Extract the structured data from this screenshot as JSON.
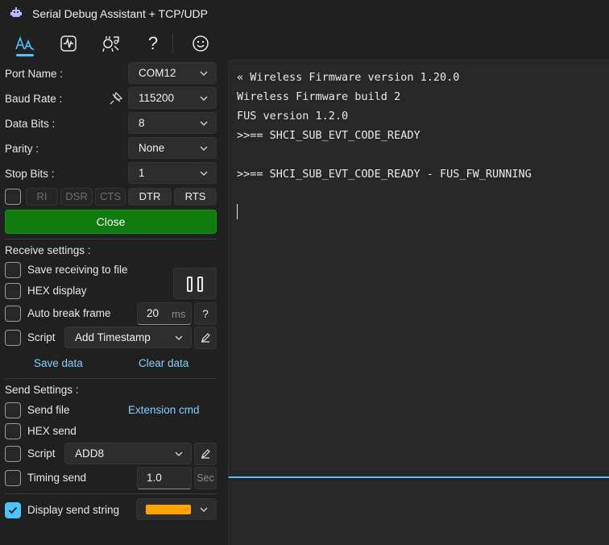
{
  "window": {
    "title": "Serial Debug Assistant + TCP/UDP"
  },
  "toolbar": {
    "icons": [
      "font-settings-icon",
      "waveform-icon",
      "tools-icon",
      "help-icon",
      "smiley-icon"
    ],
    "help_glyph": "?",
    "accent": "#4cc2ff"
  },
  "port": {
    "port_name_label": "Port Name :",
    "port_name_value": "COM12",
    "baud_rate_label": "Baud Rate :",
    "baud_rate_value": "115200",
    "data_bits_label": "Data Bits :",
    "data_bits_value": "8",
    "parity_label": "Parity :",
    "parity_value": "None",
    "stop_bits_label": "Stop Bits :",
    "stop_bits_value": "1",
    "signals": [
      "RI",
      "DSR",
      "CTS",
      "DTR",
      "RTS"
    ],
    "close_label": "Close",
    "close_color": "#0f7b0f"
  },
  "receive": {
    "title": "Receive settings :",
    "save_to_file_label": "Save receiving to file",
    "hex_display_label": "HEX display",
    "auto_break_label": "Auto break frame",
    "auto_break_value": "20",
    "auto_break_unit": "ms",
    "help_label": "?",
    "script_label": "Script",
    "script_value": "Add Timestamp",
    "save_data_label": "Save data",
    "clear_data_label": "Clear data"
  },
  "send": {
    "title": "Send Settings :",
    "send_file_label": "Send file",
    "extension_cmd_label": "Extension cmd",
    "hex_send_label": "HEX send",
    "script_label": "Script",
    "script_value": "ADD8",
    "timing_send_label": "Timing send",
    "timing_value": "1.0",
    "timing_unit": "Sec",
    "display_send_label": "Display send string",
    "display_send_checked": true,
    "display_color": "#ffa500"
  },
  "output": {
    "lines": [
      "« Wireless Firmware version 1.20.0",
      "Wireless Firmware build 2",
      "FUS version 1.2.0",
      ">>== SHCI_SUB_EVT_CODE_READY",
      "",
      ">>== SHCI_SUB_EVT_CODE_READY - FUS_FW_RUNNING"
    ]
  }
}
